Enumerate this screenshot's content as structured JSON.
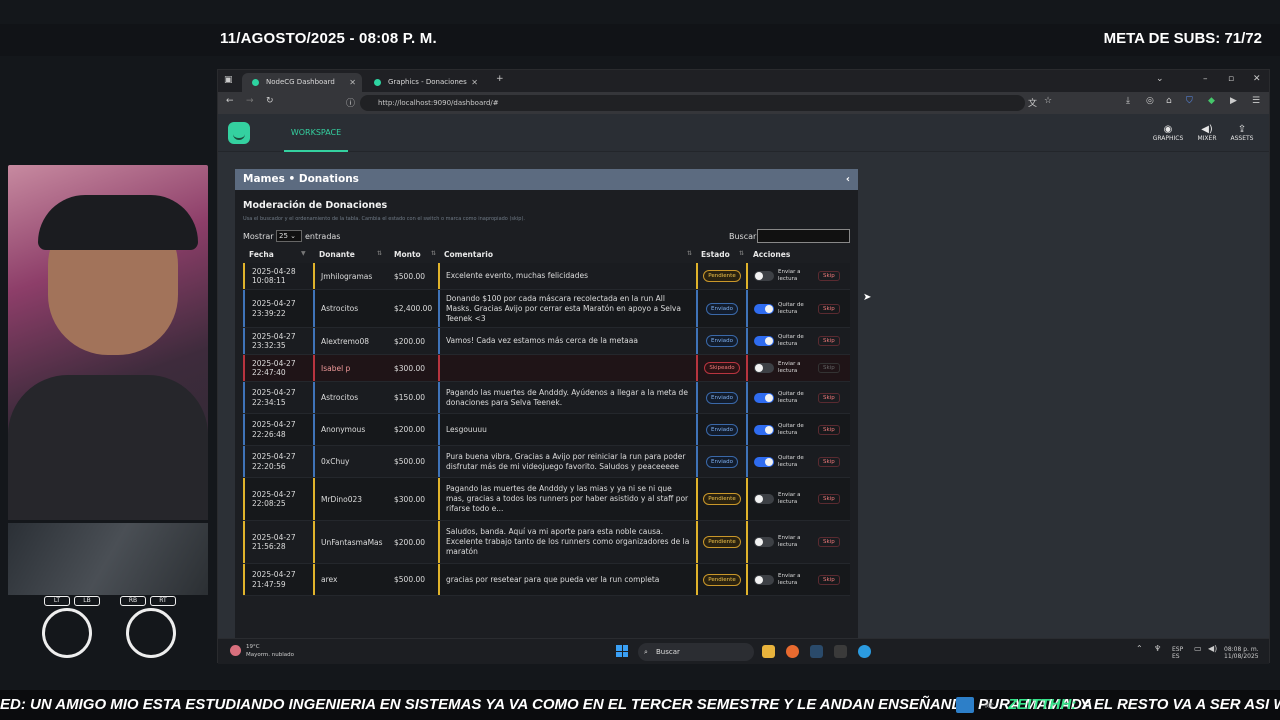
{
  "overlay": {
    "date": "11/AGOSTO/2025 - 08:08 P. M.",
    "subs_goal": "META DE SUBS: 71/72",
    "ticker_msg": "ED: UN AMIGO MIO ESTA ESTUDIANDO INGENIERIA EN SISTEMAS YA VA COMO EN EL TERCER SEMESTRE Y LE ANDAN ENSEÑANDO PURA MAMADA",
    "ticker_user": "ZEITTHH:",
    "ticker_msg2": "Y EL RESTO VA A SER ASI WEY",
    "controller_labels": [
      "LT",
      "LB",
      "RB",
      "RT"
    ]
  },
  "browser": {
    "tabs": [
      {
        "label": "NodeCG Dashboard",
        "active": true
      },
      {
        "label": "Graphics - Donaciones",
        "active": false
      }
    ],
    "url": "http://localhost:9090/dashboard/#"
  },
  "app": {
    "workspace_label": "WORKSPACE",
    "nav": [
      {
        "label": "GRAPHICS",
        "icon": "eye-icon"
      },
      {
        "label": "MIXER",
        "icon": "speaker-icon"
      },
      {
        "label": "ASSETS",
        "icon": "upload-icon"
      }
    ]
  },
  "panel": {
    "header": "Mames • Donations",
    "title": "Moderación de Donaciones",
    "hint": "Usa el buscador y el ordenamiento de la tabla. Cambia el estado con el switch o marca como inapropiado (skip).",
    "show_label": "Mostrar",
    "show_value": "25",
    "entries_label": "entradas",
    "search_label": "Buscar:",
    "columns": [
      "Fecha",
      "Donante",
      "Monto",
      "Comentario",
      "Estado",
      "Acciones"
    ],
    "skip_label": "Skip",
    "rows": [
      {
        "date": "2025-04-28",
        "time": "10:08:11",
        "donor": "Jmhilogramas",
        "amount": "$500.00",
        "comment": "Excelente evento, muchas felicidades",
        "status": "Pendiente",
        "action": "Enviar a lectura",
        "toggle_on": false
      },
      {
        "date": "2025-04-27",
        "time": "23:39:22",
        "donor": "Astrocitos",
        "amount": "$2,400.00",
        "comment": "Donando $100 por cada máscara recolectada en la run All Masks. Gracias Avijo por cerrar esta Maratón en apoyo a Selva Teenek <3",
        "status": "Enviado",
        "action": "Quitar de lectura",
        "toggle_on": true
      },
      {
        "date": "2025-04-27",
        "time": "23:32:35",
        "donor": "Alextremo08",
        "amount": "$200.00",
        "comment": "Vamos! Cada vez estamos más cerca de la metaaa",
        "status": "Enviado",
        "action": "Quitar de lectura",
        "toggle_on": true
      },
      {
        "date": "2025-04-27",
        "time": "22:47:40",
        "donor": "Isabel p",
        "amount": "$300.00",
        "comment": "",
        "status": "Skipeado",
        "action": "Enviar a lectura",
        "toggle_on": false
      },
      {
        "date": "2025-04-27",
        "time": "22:34:15",
        "donor": "Astrocitos",
        "amount": "$150.00",
        "comment": "Pagando las muertes de Andddy. Ayúdenos a llegar a la meta de donaciones para Selva Teenek.",
        "status": "Enviado",
        "action": "Quitar de lectura",
        "toggle_on": true
      },
      {
        "date": "2025-04-27",
        "time": "22:26:48",
        "donor": "Anonymous",
        "amount": "$200.00",
        "comment": "Lesgouuuu",
        "status": "Enviado",
        "action": "Quitar de lectura",
        "toggle_on": true
      },
      {
        "date": "2025-04-27",
        "time": "22:20:56",
        "donor": "0xChuy",
        "amount": "$500.00",
        "comment": "Pura buena vibra, Gracias a Avijo por reiniciar la run para poder disfrutar más de mi videojuego favorito. Saludos y peaceeeee",
        "status": "Enviado",
        "action": "Quitar de lectura",
        "toggle_on": true
      },
      {
        "date": "2025-04-27",
        "time": "22:08:25",
        "donor": "MrDino023",
        "amount": "$300.00",
        "comment": "Pagando las muertes de Andddy y las mias y ya ni se ni que mas, gracias a todos los runners por haber asistido y al staff por rifarse todo e...",
        "status": "Pendiente",
        "action": "Enviar a lectura",
        "toggle_on": false
      },
      {
        "date": "2025-04-27",
        "time": "21:56:28",
        "donor": "UnFantasmaMas",
        "amount": "$200.00",
        "comment": "Saludos, banda. Aquí va mi aporte para esta noble causa. Excelente trabajo tanto de los runners como organizadores de la maratón",
        "status": "Pendiente",
        "action": "Enviar a lectura",
        "toggle_on": false
      },
      {
        "date": "2025-04-27",
        "time": "21:47:59",
        "donor": "arex",
        "amount": "$500.00",
        "comment": "gracias por resetear para que pueda ver la run completa",
        "status": "Pendiente",
        "action": "Enviar a lectura",
        "toggle_on": false
      }
    ]
  },
  "taskbar": {
    "temp": "19°C",
    "weather": "Mayorm. nublado",
    "search": "Buscar",
    "lang": "ESP",
    "lang2": "ES",
    "time": "08:08 p. m.",
    "date": "11/08/2025"
  }
}
